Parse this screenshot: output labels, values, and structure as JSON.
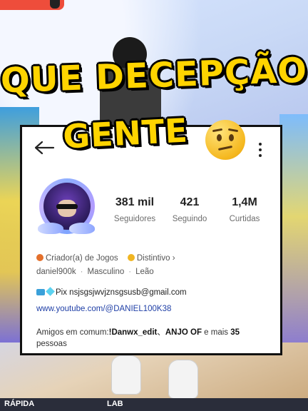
{
  "headline": {
    "line1": "QUE DECEPÇÃO",
    "line2": "GENTE"
  },
  "profile": {
    "stats": [
      {
        "value": "381 mil",
        "label": "Seguidores"
      },
      {
        "value": "421",
        "label": "Seguindo"
      },
      {
        "value": "1,4M",
        "label": "Curtidas"
      }
    ],
    "category": "Criador(a) de Jogos",
    "distinctive": "Distintivo",
    "distinctive_chevron": "›",
    "username": "daniel900k",
    "gender": "Masculino",
    "sign": "Leão",
    "separator": "·",
    "pix_text": "Pix nsjsgsjwvjznsgsusb@gmail.com",
    "link": "www.youtube.com/@DANIEL100K38",
    "mutual_prefix": "Amigos em comum:",
    "mutual_name1": "!Danwx_edit",
    "mutual_sep": "、",
    "mutual_name2": "ANJO OF",
    "mutual_mid": " e mais ",
    "mutual_count": "35",
    "mutual_suffix": " pessoas"
  },
  "bottom_bar": {
    "left_label": "RÁPIDA",
    "right_label": "LAB"
  },
  "colors": {
    "headline": "#ffd400",
    "link": "#1f3fa6",
    "badge": "#e4702c"
  }
}
